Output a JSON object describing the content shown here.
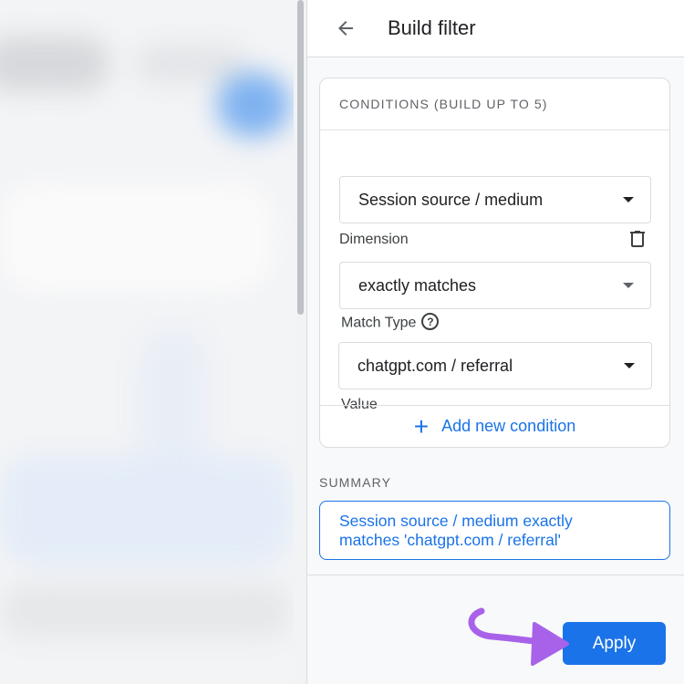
{
  "header": {
    "title": "Build filter"
  },
  "conditions": {
    "heading": "CONDITIONS (BUILD UP TO 5)",
    "dimension": {
      "label": "Dimension",
      "value": "Session source / medium"
    },
    "match_type": {
      "label": "Match Type",
      "help": "?",
      "value": "exactly matches"
    },
    "value": {
      "label": "Value",
      "value": "chatgpt.com / referral"
    },
    "add_label": "Add new condition",
    "add_icon": "+"
  },
  "summary": {
    "title": "SUMMARY",
    "text_line1": "Session source / medium exactly",
    "text_line2": "matches 'chatgpt.com / referral'"
  },
  "apply_label": "Apply",
  "colors": {
    "accent": "#1a73e8",
    "annotation_arrow": "#a862ea"
  },
  "icons": [
    "arrow-back-icon",
    "trash-icon",
    "help-icon",
    "plus-icon",
    "dropdown-caret-icon",
    "annotation-arrow-icon"
  ]
}
